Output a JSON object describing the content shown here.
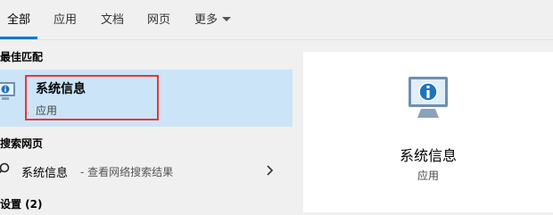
{
  "tabs": [
    {
      "label": "全部",
      "active": true
    },
    {
      "label": "应用"
    },
    {
      "label": "文档"
    },
    {
      "label": "网页"
    },
    {
      "label": "更多",
      "has_dropdown": true
    }
  ],
  "sections": {
    "best_match": "最佳匹配",
    "web_search": "搜索网页",
    "settings": "设置 (2)"
  },
  "best_match": {
    "title": "系统信息",
    "subtitle": "应用",
    "icon": "system-info-icon",
    "highlight_color": "#e53935",
    "bg_color": "#cce4f7"
  },
  "web_result": {
    "title": "系统信息",
    "description": "- 查看网络搜索结果",
    "icon": "search-icon"
  },
  "detail": {
    "title": "系统信息",
    "subtitle": "应用",
    "icon": "system-info-icon"
  },
  "accent_color": "#0078d7"
}
